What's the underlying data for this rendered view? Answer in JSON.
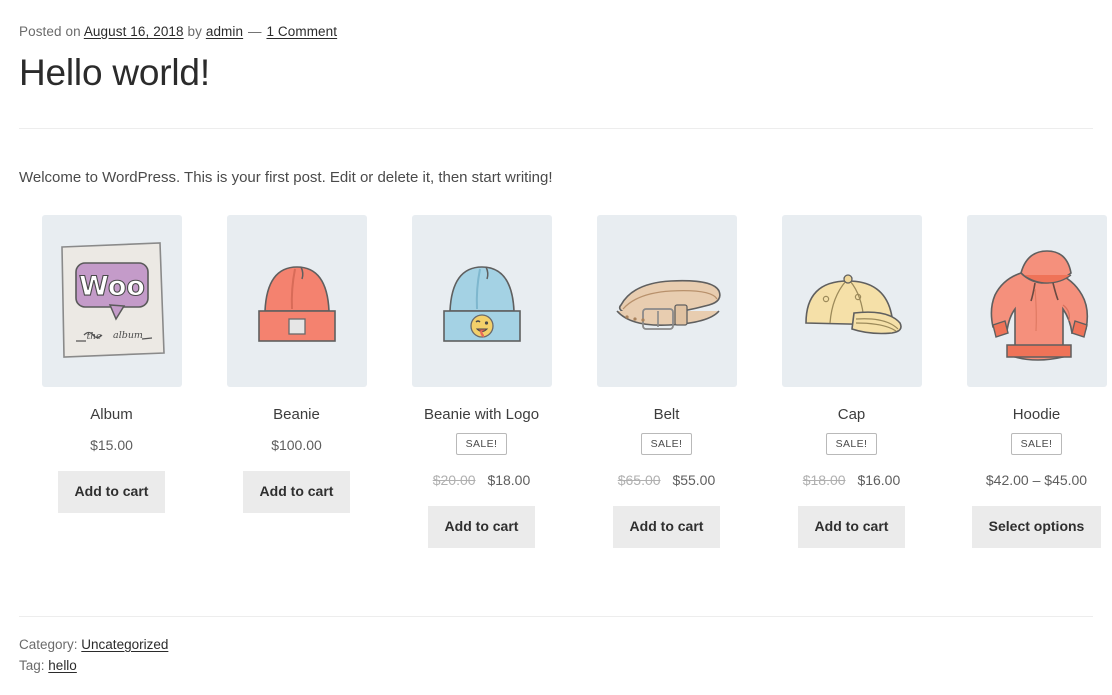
{
  "post": {
    "meta_posted_label": "Posted on",
    "meta_date": "August 16, 2018",
    "meta_by_label": "by",
    "meta_author": "admin",
    "meta_separator": "—",
    "meta_comments": "1 Comment",
    "title": "Hello world!",
    "content": "Welcome to WordPress. This is your first post. Edit or delete it, then start writing!"
  },
  "products": [
    {
      "name": "Album",
      "icon": "album-cover-icon",
      "on_sale": false,
      "sale_label": "",
      "old_price": "",
      "price": "$15.00",
      "button": "Add to cart"
    },
    {
      "name": "Beanie",
      "icon": "beanie-icon",
      "on_sale": false,
      "sale_label": "",
      "old_price": "",
      "price": "$100.00",
      "button": "Add to cart"
    },
    {
      "name": "Beanie with Logo",
      "icon": "beanie-with-logo-icon",
      "on_sale": true,
      "sale_label": "SALE!",
      "old_price": "$20.00",
      "price": "$18.00",
      "button": "Add to cart"
    },
    {
      "name": "Belt",
      "icon": "belt-icon",
      "on_sale": true,
      "sale_label": "SALE!",
      "old_price": "$65.00",
      "price": "$55.00",
      "button": "Add to cart"
    },
    {
      "name": "Cap",
      "icon": "cap-icon",
      "on_sale": true,
      "sale_label": "SALE!",
      "old_price": "$18.00",
      "price": "$16.00",
      "button": "Add to cart"
    },
    {
      "name": "Hoodie",
      "icon": "hoodie-icon",
      "on_sale": true,
      "sale_label": "SALE!",
      "old_price": "",
      "price": "$42.00 – $45.00",
      "button": "Select options"
    }
  ],
  "footer": {
    "category_label": "Category:",
    "category": "Uncategorized",
    "tag_label": "Tag:",
    "tag": "hello"
  },
  "colors": {
    "thumb_background": "#e8edf1",
    "button_background": "#ebebeb",
    "rule": "#ededed",
    "text": "#3c3c3c",
    "muted_text": "#6b6b6b",
    "strikethrough": "#b0b0b0"
  }
}
